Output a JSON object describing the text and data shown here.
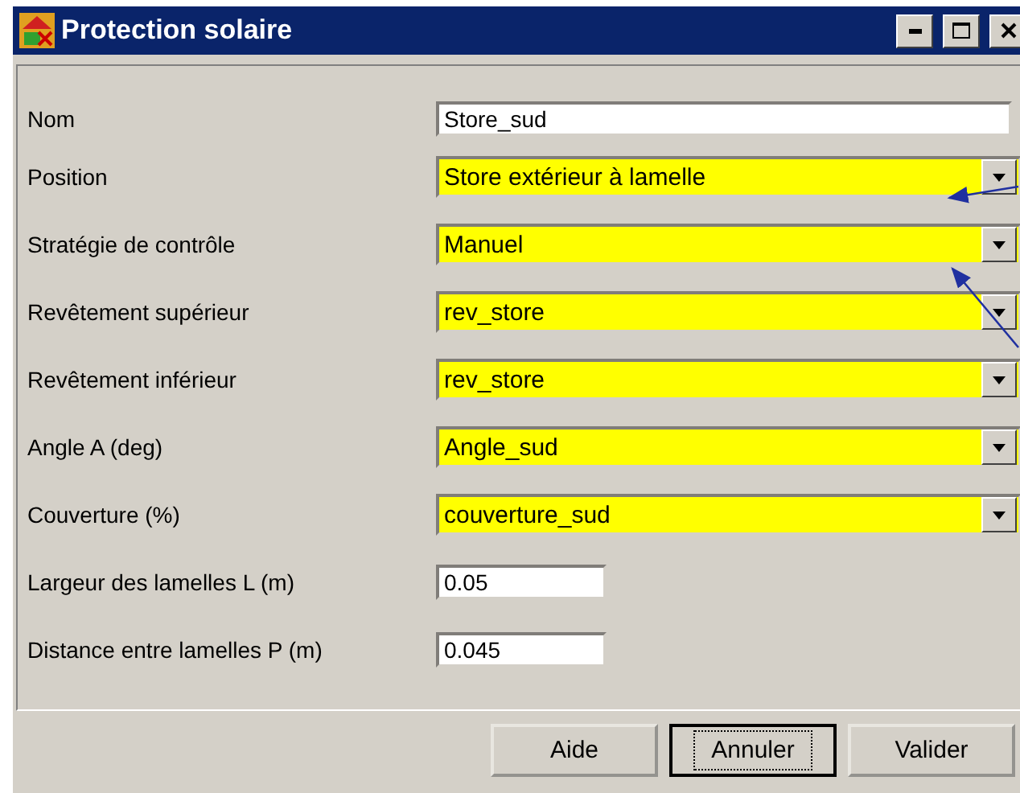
{
  "window": {
    "title": "Protection solaire"
  },
  "fields": [
    {
      "label": "Nom",
      "kind": "text",
      "value": "Store_sud"
    },
    {
      "label": "Position",
      "kind": "dropdown",
      "value": "Store extérieur à lamelle"
    },
    {
      "label": "Stratégie de contrôle",
      "kind": "dropdown",
      "value": "Manuel"
    },
    {
      "label": "Revêtement supérieur",
      "kind": "dropdown",
      "value": "rev_store"
    },
    {
      "label": "Revêtement inférieur",
      "kind": "dropdown",
      "value": "rev_store"
    },
    {
      "label": "Angle A (deg)",
      "kind": "dropdown",
      "value": "Angle_sud"
    },
    {
      "label": "Couverture (%)",
      "kind": "dropdown",
      "value": "couverture_sud"
    },
    {
      "label": "Largeur des lamelles L (m)",
      "kind": "short",
      "value": "0.05"
    },
    {
      "label": "Distance entre lamelles P (m)",
      "kind": "short",
      "value": "0.045"
    }
  ],
  "buttons": [
    {
      "label": "Aide",
      "focused": false
    },
    {
      "label": "Annuler",
      "focused": true
    },
    {
      "label": "Valider",
      "focused": false
    }
  ]
}
